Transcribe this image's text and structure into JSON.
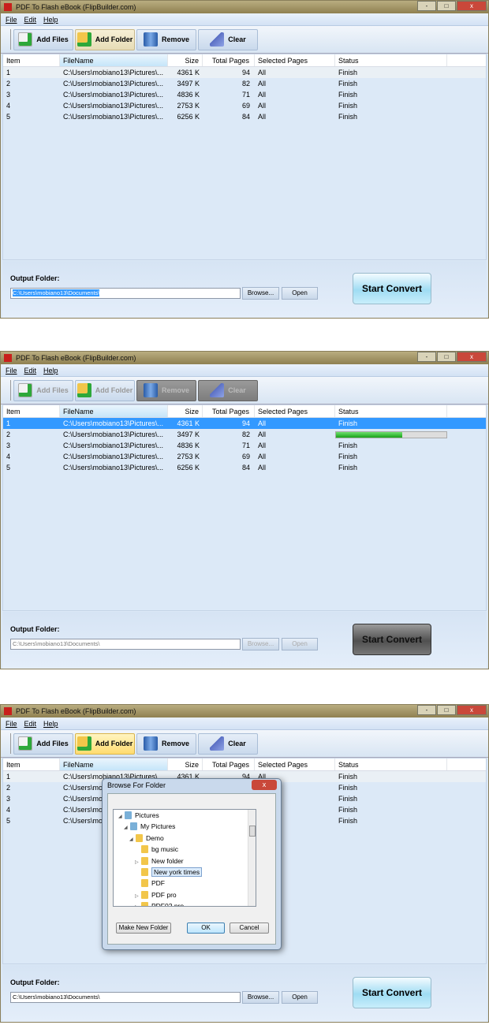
{
  "app_title": "PDF To Flash eBook (FlipBuilder.com)",
  "window_controls": [
    "-",
    "□",
    "x"
  ],
  "menu": [
    "File",
    "Edit",
    "Help"
  ],
  "toolbar": [
    {
      "label": "Add Files",
      "icon": "add-files-icon"
    },
    {
      "label": "Add Folder",
      "icon": "add-folder-icon"
    },
    {
      "label": "Remove",
      "icon": "trash-icon"
    },
    {
      "label": "Clear",
      "icon": "broom-icon"
    }
  ],
  "columns": [
    "Item",
    "FileName",
    "Size",
    "Total Pages",
    "Selected Pages",
    "Status"
  ],
  "rows": [
    [
      "1",
      "C:\\Users\\mobiano13\\Pictures\\...",
      "4361 K",
      "94",
      "All",
      "Finish"
    ],
    [
      "2",
      "C:\\Users\\mobiano13\\Pictures\\...",
      "3497 K",
      "82",
      "All",
      "Finish"
    ],
    [
      "3",
      "C:\\Users\\mobiano13\\Pictures\\...",
      "4836 K",
      "71",
      "All",
      "Finish"
    ],
    [
      "4",
      "C:\\Users\\mobiano13\\Pictures\\...",
      "2753 K",
      "69",
      "All",
      "Finish"
    ],
    [
      "5",
      "C:\\Users\\mobiano13\\Pictures\\...",
      "6256 K",
      "84",
      "All",
      "Finish"
    ]
  ],
  "output_folder_label": "Output Folder:",
  "output_folder_value": "C:\\Users\\mobiano13\\Documents\\",
  "browse_label": "Browse...",
  "open_label": "Open",
  "start_convert_label": "Start Convert",
  "screens": [
    {
      "state": "idle",
      "hover_button": "Add Folder",
      "path_selected": true
    },
    {
      "state": "converting",
      "selected_row": 1,
      "row2_status": "progress",
      "progress_percent": 60
    },
    {
      "state": "browsing",
      "hot_button": "Add Folder"
    }
  ],
  "dialog": {
    "title": "Browse For Folder",
    "close": "x",
    "tree": [
      {
        "label": "Pictures",
        "level": 0,
        "expander": "expanded",
        "icon": "pictures-icon"
      },
      {
        "label": "My Pictures",
        "level": 1,
        "expander": "expanded",
        "icon": "pictures-icon"
      },
      {
        "label": "Demo",
        "level": 2,
        "expander": "expanded",
        "icon": "folder-icon"
      },
      {
        "label": "bg music",
        "level": 3,
        "expander": "none",
        "icon": "folder-icon"
      },
      {
        "label": "New folder",
        "level": 3,
        "expander": "collapsed",
        "icon": "folder-icon"
      },
      {
        "label": "New york times",
        "level": 3,
        "expander": "none",
        "icon": "folder-icon",
        "selected": true
      },
      {
        "label": "PDF",
        "level": 3,
        "expander": "none",
        "icon": "folder-icon"
      },
      {
        "label": "PDF pro",
        "level": 3,
        "expander": "collapsed",
        "icon": "folder-icon"
      },
      {
        "label": "PDF02 pro",
        "level": 3,
        "expander": "collapsed",
        "icon": "folder-icon"
      }
    ],
    "make_new_folder": "Make New Folder",
    "ok": "OK",
    "cancel": "Cancel"
  }
}
